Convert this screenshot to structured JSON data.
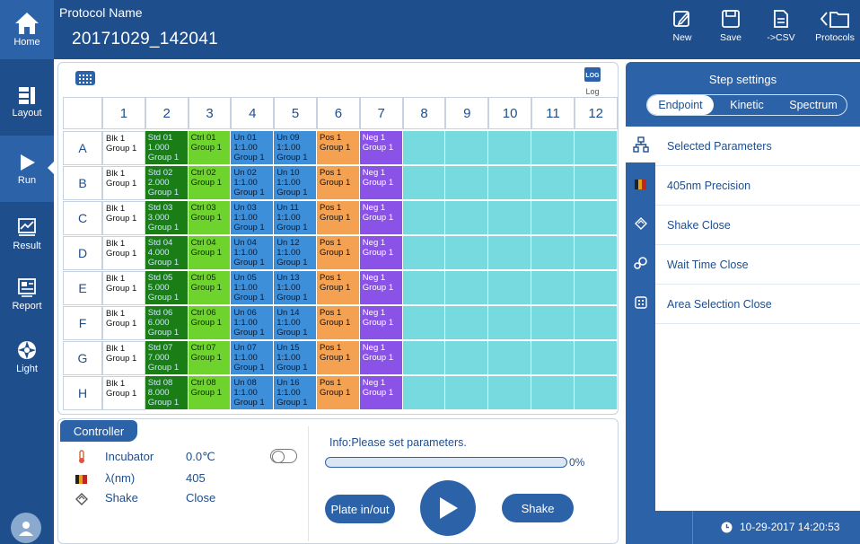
{
  "header": {
    "protocol_label": "Protocol Name",
    "protocol_name": "20171029_142041",
    "home_label": "Home",
    "buttons": [
      {
        "label": "New",
        "icon": "edit-icon"
      },
      {
        "label": "Save",
        "icon": "save-icon"
      },
      {
        "label": "->CSV",
        "icon": "export-csv-icon"
      },
      {
        "label": "Protocols",
        "icon": "folder-back-icon"
      }
    ]
  },
  "sidebar": {
    "items": [
      {
        "label": "Layout",
        "icon": "layout-icon",
        "active": false
      },
      {
        "label": "Run",
        "icon": "run-icon",
        "active": true
      },
      {
        "label": "Result",
        "icon": "result-icon",
        "active": false
      },
      {
        "label": "Report",
        "icon": "report-icon",
        "active": false
      },
      {
        "label": "Light",
        "icon": "light-icon",
        "active": false
      }
    ]
  },
  "plate": {
    "log_label": "Log",
    "log_badge": "LOG",
    "columns": [
      "1",
      "2",
      "3",
      "4",
      "5",
      "6",
      "7",
      "8",
      "9",
      "10",
      "11",
      "12"
    ],
    "rows": [
      "A",
      "B",
      "C",
      "D",
      "E",
      "F",
      "G",
      "H"
    ],
    "cells": [
      [
        {
          "t": "blank",
          "text": "Blk 1\nGroup 1"
        },
        {
          "t": "std",
          "text": "Std 01\n1.000\nGroup 1"
        },
        {
          "t": "ctrl",
          "text": "Ctrl 01\nGroup 1"
        },
        {
          "t": "un",
          "text": "Un 01\n1:1.00\nGroup 1"
        },
        {
          "t": "un",
          "text": "Un 09\n1:1.00\nGroup 1"
        },
        {
          "t": "pos",
          "text": "Pos 1\nGroup 1"
        },
        {
          "t": "neg",
          "text": "Neg 1\nGroup 1"
        }
      ],
      [
        {
          "t": "blank",
          "text": "Blk 1\nGroup 1"
        },
        {
          "t": "std",
          "text": "Std 02\n2.000\nGroup 1"
        },
        {
          "t": "ctrl",
          "text": "Ctrl 02\nGroup 1"
        },
        {
          "t": "un",
          "text": "Un 02\n1:1.00\nGroup 1"
        },
        {
          "t": "un",
          "text": "Un 10\n1:1.00\nGroup 1"
        },
        {
          "t": "pos",
          "text": "Pos 1\nGroup 1"
        },
        {
          "t": "neg",
          "text": "Neg 1\nGroup 1"
        }
      ],
      [
        {
          "t": "blank",
          "text": "Blk 1\nGroup 1"
        },
        {
          "t": "std",
          "text": "Std 03\n3.000\nGroup 1"
        },
        {
          "t": "ctrl",
          "text": "Ctrl 03\nGroup 1"
        },
        {
          "t": "un",
          "text": "Un 03\n1:1.00\nGroup 1"
        },
        {
          "t": "un",
          "text": "Un 11\n1:1.00\nGroup 1"
        },
        {
          "t": "pos",
          "text": "Pos 1\nGroup 1"
        },
        {
          "t": "neg",
          "text": "Neg 1\nGroup 1"
        }
      ],
      [
        {
          "t": "blank",
          "text": "Blk 1\nGroup 1"
        },
        {
          "t": "std",
          "text": "Std 04\n4.000\nGroup 1"
        },
        {
          "t": "ctrl",
          "text": "Ctrl 04\nGroup 1"
        },
        {
          "t": "un",
          "text": "Un 04\n1:1.00\nGroup 1"
        },
        {
          "t": "un",
          "text": "Un 12\n1:1.00\nGroup 1"
        },
        {
          "t": "pos",
          "text": "Pos 1\nGroup 1"
        },
        {
          "t": "neg",
          "text": "Neg 1\nGroup 1"
        }
      ],
      [
        {
          "t": "blank",
          "text": "Blk 1\nGroup 1"
        },
        {
          "t": "std",
          "text": "Std 05\n5.000\nGroup 1"
        },
        {
          "t": "ctrl",
          "text": "Ctrl 05\nGroup 1"
        },
        {
          "t": "un",
          "text": "Un 05\n1:1.00\nGroup 1"
        },
        {
          "t": "un",
          "text": "Un 13\n1:1.00\nGroup 1"
        },
        {
          "t": "pos",
          "text": "Pos 1\nGroup 1"
        },
        {
          "t": "neg",
          "text": "Neg 1\nGroup 1"
        }
      ],
      [
        {
          "t": "blank",
          "text": "Blk 1\nGroup 1"
        },
        {
          "t": "std",
          "text": "Std 06\n6.000\nGroup 1"
        },
        {
          "t": "ctrl",
          "text": "Ctrl 06\nGroup 1"
        },
        {
          "t": "un",
          "text": "Un 06\n1:1.00\nGroup 1"
        },
        {
          "t": "un",
          "text": "Un 14\n1:1.00\nGroup 1"
        },
        {
          "t": "pos",
          "text": "Pos 1\nGroup 1"
        },
        {
          "t": "neg",
          "text": "Neg 1\nGroup 1"
        }
      ],
      [
        {
          "t": "blank",
          "text": "Blk 1\nGroup 1"
        },
        {
          "t": "std",
          "text": "Std 07\n7.000\nGroup 1"
        },
        {
          "t": "ctrl",
          "text": "Ctrl 07\nGroup 1"
        },
        {
          "t": "un",
          "text": "Un 07\n1:1.00\nGroup 1"
        },
        {
          "t": "un",
          "text": "Un 15\n1:1.00\nGroup 1"
        },
        {
          "t": "pos",
          "text": "Pos 1\nGroup 1"
        },
        {
          "t": "neg",
          "text": "Neg 1\nGroup 1"
        }
      ],
      [
        {
          "t": "blank",
          "text": "Blk 1\nGroup 1"
        },
        {
          "t": "std",
          "text": "Std 08\n8.000\nGroup 1"
        },
        {
          "t": "ctrl",
          "text": "Ctrl 08\nGroup 1"
        },
        {
          "t": "un",
          "text": "Un 08\n1:1.00\nGroup 1"
        },
        {
          "t": "un",
          "text": "Un 16\n1:1.00\nGroup 1"
        },
        {
          "t": "pos",
          "text": "Pos 1\nGroup 1"
        },
        {
          "t": "neg",
          "text": "Neg 1\nGroup 1"
        }
      ]
    ]
  },
  "controller": {
    "tab_label": "Controller",
    "incubator_label": "Incubator",
    "incubator_value": "0.0℃",
    "incubator_on": false,
    "wavelength_label": "λ(nm)",
    "wavelength_value": "405",
    "shake_label": "Shake",
    "shake_value": "Close",
    "info": "Info:Please set parameters.",
    "progress": 0,
    "progress_text": "0%",
    "plate_button": "Plate in/out",
    "shake_button": "Shake"
  },
  "step_settings": {
    "title": "Step settings",
    "modes": [
      "Endpoint",
      "Kinetic",
      "Spectrum"
    ],
    "active_mode": "Endpoint",
    "params": [
      {
        "label": "Selected Parameters",
        "icon": "parameters-tree-icon"
      },
      {
        "label": "405nm  Precision",
        "icon": "wavelength-icon"
      },
      {
        "label": "Shake Close",
        "icon": "shake-icon"
      },
      {
        "label": "Wait Time Close",
        "icon": "wait-time-icon"
      },
      {
        "label": "Area Selection Close",
        "icon": "area-selection-icon"
      }
    ],
    "datetime": "10-29-2017 14:20:53"
  },
  "colors": {
    "primary": "#1f4e8c",
    "accent": "#2b62a8",
    "std": "#1a7d16",
    "ctrl": "#6fd32e",
    "un": "#3d8fd9",
    "pos": "#f5a152",
    "neg": "#8b52e8",
    "empty_well": "#77dade"
  }
}
